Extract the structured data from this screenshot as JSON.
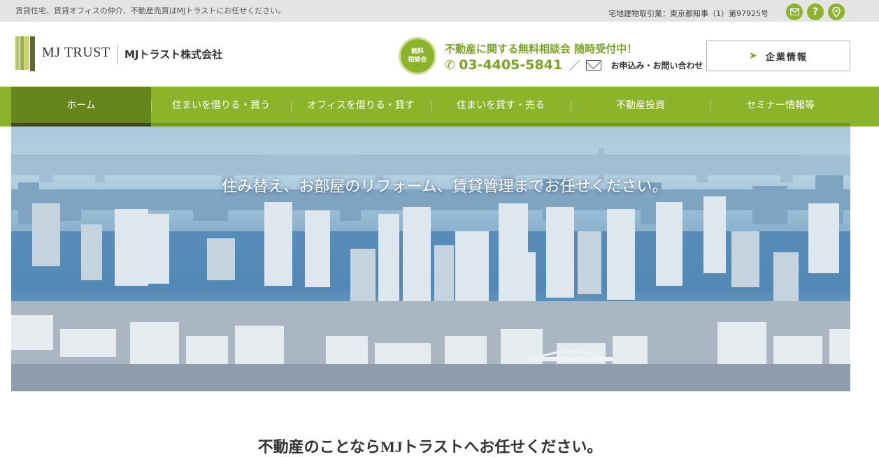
{
  "topbar": {
    "tagline": "賃貸住宅、賃貸オフィスの仲介、不動産売買はMJトラストにお任せください。",
    "license": "宅地建物取引業：東京都知事（1）第97925号",
    "icons": [
      "mail-icon",
      "help-icon",
      "map-pin-icon"
    ],
    "help_glyph": "?"
  },
  "header": {
    "logo_en": "MJ TRUST",
    "logo_jp": "MJトラスト株式会社",
    "badge_line1": "無料",
    "badge_line2": "相談会",
    "consult_title": "不動産に関する無料相談会 随時受付中！",
    "phone": "03-4405-5841",
    "slash": "／",
    "inquiry": "お申込み・お問い合わせ",
    "corp_button": "企業情報"
  },
  "nav": {
    "items": [
      {
        "label": "ホーム",
        "active": true
      },
      {
        "label": "住まいを借りる・買う",
        "active": false
      },
      {
        "label": "オフィスを借りる・貸す",
        "active": false
      },
      {
        "label": "住まいを貸す・売る",
        "active": false
      },
      {
        "label": "不動産投資",
        "active": false
      },
      {
        "label": "セミナー情報等",
        "active": false
      }
    ]
  },
  "hero": {
    "caption": "住み替え、お部屋のリフォーム、賃貸管理までお任せください。"
  },
  "main": {
    "title": "不動産のことならMJトラストへお任せください。"
  },
  "colors": {
    "accent": "#8bb42a",
    "accent_dark": "#66851c",
    "text_green": "#7aa321",
    "topbar_bg": "#e4e4e4"
  }
}
